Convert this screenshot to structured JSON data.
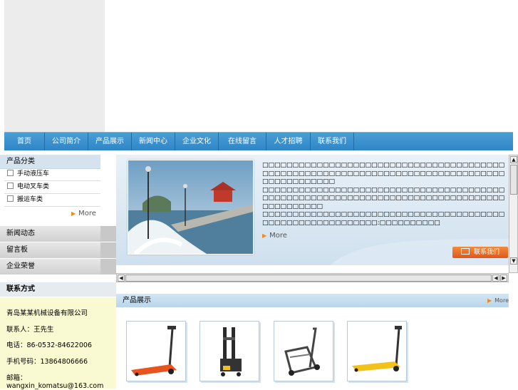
{
  "nav": {
    "items": [
      "首页",
      "公司简介",
      "产品展示",
      "新闻中心",
      "企业文化",
      "在线留言",
      "人才招聘",
      "联系我们"
    ]
  },
  "sidebar": {
    "categories_title": "产品分类",
    "categories": [
      "手动液压车",
      "电动叉车类",
      "搬运车类"
    ],
    "more_label": "More",
    "tabs": [
      "新闻动态",
      "留言板",
      "企业荣誉"
    ]
  },
  "contact": {
    "title": "联系方式",
    "company": "青岛某某机械设备有限公司",
    "person": "联系人：王先生",
    "phone": "电话：86-0532-84622006",
    "mobile": "手机号码：13864806666",
    "email": "邮箱：wangxin_komatsu@163.com"
  },
  "intro": {
    "paragraph1": "□□□□□□□□□□□□□□□□□□□□□□□□□□□□□□□□□□□□□□□□□□□□□□□□□□□□□□□□□□□□□□□□□□□□□□□□□□□□□□□□□□□□□□□□□□□□",
    "paragraph2": "□□□□□□□□□□□□□□□□□□□□□□□□□□□□□□□□□□□□□□□□□□□□□□□□□□□□□□□□□□□□□□□□□□□□□□□□□□□□□□□□□□□□□□□□□□",
    "paragraph3": "□□□□□□□□□□□□□□□□□□□□□□□□□□□□□□□□□□□□□□□□□□□□□□□□□□□□□□□□□□□:□□□□□□□□□□",
    "more_label": "More",
    "contact_button": "联系我们"
  },
  "products": {
    "title": "产品展示",
    "more_label": "More",
    "items": [
      {
        "name": "orange-pallet-truck",
        "color": "#e8531e"
      },
      {
        "name": "black-electric-stacker",
        "color": "#2b2b2b"
      },
      {
        "name": "silver-hand-trolley",
        "color": "#444444"
      },
      {
        "name": "yellow-pallet-truck",
        "color": "#f2c21a"
      }
    ]
  },
  "colors": {
    "nav": "#3a92cf",
    "accent": "#f08a1c",
    "contact_bg": "#fafad2"
  }
}
